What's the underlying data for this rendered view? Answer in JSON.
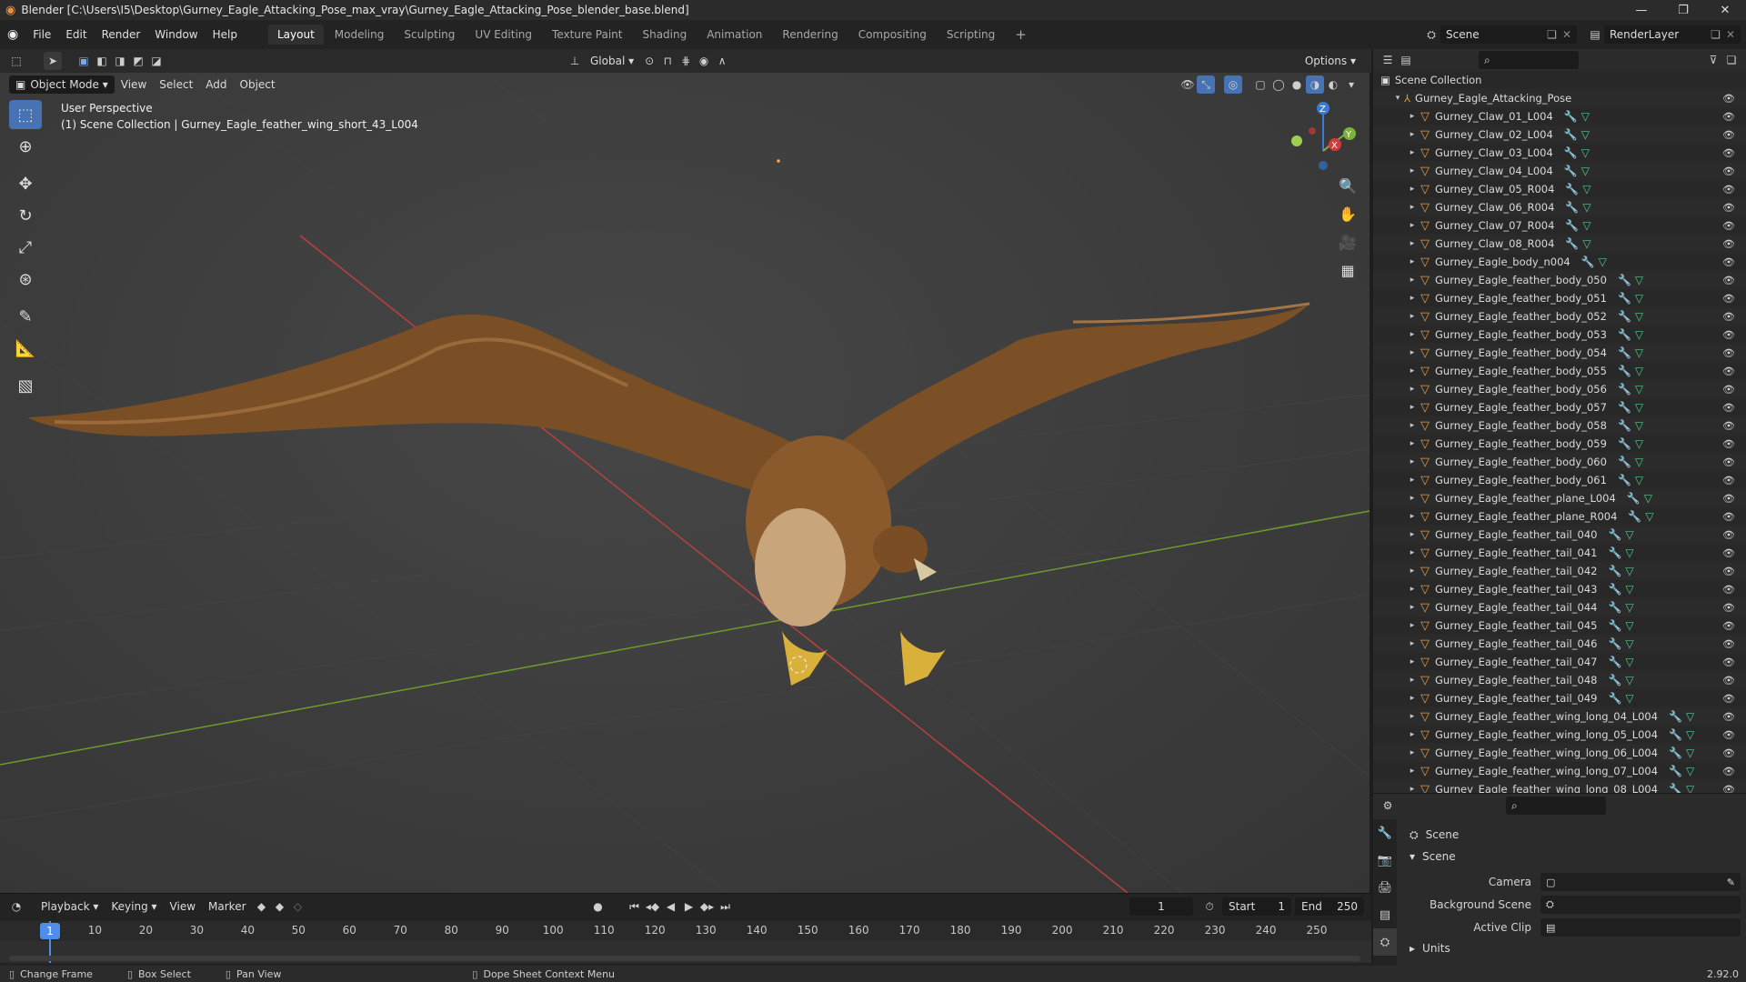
{
  "window": {
    "title": "Blender [C:\\Users\\I5\\Desktop\\Gurney_Eagle_Attacking_Pose_max_vray\\Gurney_Eagle_Attacking_Pose_blender_base.blend]",
    "minimize": "—",
    "maximize": "❐",
    "close": "✕"
  },
  "menu": [
    "File",
    "Edit",
    "Render",
    "Window",
    "Help"
  ],
  "workspaces": [
    {
      "label": "Layout",
      "active": true
    },
    {
      "label": "Modeling"
    },
    {
      "label": "Sculpting"
    },
    {
      "label": "UV Editing"
    },
    {
      "label": "Texture Paint"
    },
    {
      "label": "Shading"
    },
    {
      "label": "Animation"
    },
    {
      "label": "Rendering"
    },
    {
      "label": "Compositing"
    },
    {
      "label": "Scripting"
    }
  ],
  "scene_selector": {
    "value": "Scene"
  },
  "view_layer_selector": {
    "value": "RenderLayer"
  },
  "tool_header": {
    "orientation": "Global",
    "options": "Options"
  },
  "viewport_header": {
    "mode": "Object Mode",
    "view": "View",
    "select": "Select",
    "add": "Add",
    "object": "Object"
  },
  "viewport_info": {
    "line1": "User Perspective",
    "line2": "(1) Scene Collection | Gurney_Eagle_feather_wing_short_43_L004"
  },
  "gizmo": {
    "z": "Z",
    "x": "X",
    "y": "Y"
  },
  "outliner": {
    "scene_collection": "Scene Collection",
    "root": "Gurney_Eagle_Attacking_Pose",
    "items": [
      "Gurney_Claw_01_L004",
      "Gurney_Claw_02_L004",
      "Gurney_Claw_03_L004",
      "Gurney_Claw_04_L004",
      "Gurney_Claw_05_R004",
      "Gurney_Claw_06_R004",
      "Gurney_Claw_07_R004",
      "Gurney_Claw_08_R004",
      "Gurney_Eagle_body_n004",
      "Gurney_Eagle_feather_body_050",
      "Gurney_Eagle_feather_body_051",
      "Gurney_Eagle_feather_body_052",
      "Gurney_Eagle_feather_body_053",
      "Gurney_Eagle_feather_body_054",
      "Gurney_Eagle_feather_body_055",
      "Gurney_Eagle_feather_body_056",
      "Gurney_Eagle_feather_body_057",
      "Gurney_Eagle_feather_body_058",
      "Gurney_Eagle_feather_body_059",
      "Gurney_Eagle_feather_body_060",
      "Gurney_Eagle_feather_body_061",
      "Gurney_Eagle_feather_plane_L004",
      "Gurney_Eagle_feather_plane_R004",
      "Gurney_Eagle_feather_tail_040",
      "Gurney_Eagle_feather_tail_041",
      "Gurney_Eagle_feather_tail_042",
      "Gurney_Eagle_feather_tail_043",
      "Gurney_Eagle_feather_tail_044",
      "Gurney_Eagle_feather_tail_045",
      "Gurney_Eagle_feather_tail_046",
      "Gurney_Eagle_feather_tail_047",
      "Gurney_Eagle_feather_tail_048",
      "Gurney_Eagle_feather_tail_049",
      "Gurney_Eagle_feather_wing_long_04_L004",
      "Gurney_Eagle_feather_wing_long_05_L004",
      "Gurney_Eagle_feather_wing_long_06_L004",
      "Gurney_Eagle_feather_wing_long_07_L004",
      "Gurney_Eagle_feather_wing_long_08_L004"
    ]
  },
  "properties": {
    "context": "Scene",
    "panel": "Scene",
    "camera_label": "Camera",
    "background_scene_label": "Background Scene",
    "active_clip_label": "Active Clip",
    "units_label": "Units"
  },
  "timeline": {
    "playback": "Playback",
    "keying": "Keying",
    "view": "View",
    "marker": "Marker",
    "current_frame": "1",
    "start_label": "Start",
    "start": "1",
    "end_label": "End",
    "end": "250",
    "ticks": [
      "1",
      "10",
      "20",
      "30",
      "40",
      "50",
      "60",
      "70",
      "80",
      "90",
      "100",
      "110",
      "120",
      "130",
      "140",
      "150",
      "160",
      "170",
      "180",
      "190",
      "200",
      "210",
      "220",
      "230",
      "240",
      "250"
    ]
  },
  "statusbar": {
    "change_frame": "Change Frame",
    "box_select": "Box Select",
    "pan_view": "Pan View",
    "context_menu": "Dope Sheet Context Menu",
    "version": "2.92.0"
  }
}
